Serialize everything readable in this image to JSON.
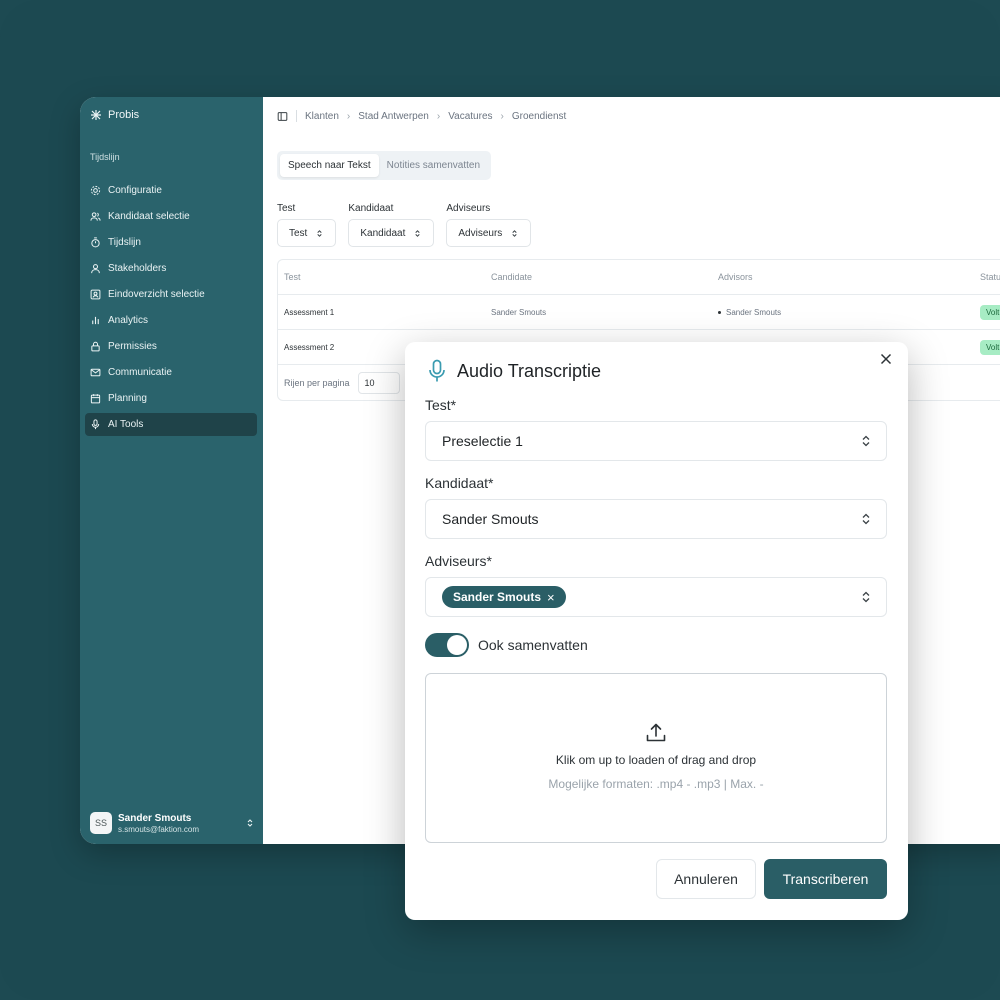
{
  "brand": {
    "name": "Probis"
  },
  "sidebar": {
    "section_label": "Tijdslijn",
    "items": [
      {
        "label": "Configuratie",
        "icon": "gear-icon"
      },
      {
        "label": "Kandidaat selectie",
        "icon": "users-icon"
      },
      {
        "label": "Tijdslijn",
        "icon": "timer-icon"
      },
      {
        "label": "Stakeholders",
        "icon": "user-icon"
      },
      {
        "label": "Eindoverzicht selectie",
        "icon": "id-card-icon"
      },
      {
        "label": "Analytics",
        "icon": "bar-chart-icon"
      },
      {
        "label": "Permissies",
        "icon": "lock-icon"
      },
      {
        "label": "Communicatie",
        "icon": "mail-icon"
      },
      {
        "label": "Planning",
        "icon": "calendar-icon"
      },
      {
        "label": "AI Tools",
        "icon": "microphone-icon"
      }
    ],
    "active": "AI Tools",
    "user": {
      "initials": "SS",
      "name": "Sander Smouts",
      "email": "s.smouts@faktion.com"
    }
  },
  "breadcrumb": [
    "Klanten",
    "Stad Antwerpen",
    "Vacatures",
    "Groendienst"
  ],
  "tabs": [
    {
      "label": "Speech naar Tekst",
      "active": true
    },
    {
      "label": "Notities samenvatten",
      "active": false
    }
  ],
  "filters": [
    {
      "label": "Test",
      "value": "Test"
    },
    {
      "label": "Kandidaat",
      "value": "Kandidaat"
    },
    {
      "label": "Adviseurs",
      "value": "Adviseurs"
    }
  ],
  "table": {
    "headers": [
      "Test",
      "Candidate",
      "Advisors",
      "Status"
    ],
    "header_status_visible": "Statu",
    "rows": [
      {
        "test": "Assessment 1",
        "candidate": "Sander Smouts",
        "advisor": "Sander Smouts",
        "status": "Volt"
      },
      {
        "test": "Assessment 2",
        "candidate": "",
        "advisor": "",
        "status": "Volt"
      }
    ],
    "rows_per_page_label": "Rijen per pagina",
    "rows_per_page_value": "10"
  },
  "modal": {
    "title": "Audio Transcriptie",
    "test_label": "Test*",
    "test_value": "Preselectie 1",
    "candidate_label": "Kandidaat*",
    "candidate_value": "Sander Smouts",
    "advisors_label": "Adviseurs*",
    "advisor_chip": "Sander Smouts",
    "toggle_label": "Ook samenvatten",
    "toggle_on": true,
    "upload_main": "Klik om up to loaden of drag and drop",
    "upload_sub": "Mogelijke formaten: .mp4 - .mp3 | Max. -",
    "cancel_label": "Annuleren",
    "submit_label": "Transcriberen"
  },
  "colors": {
    "background": "#1c4951",
    "sidebar": "#2a636c",
    "accent": "#2a5e66",
    "status_badge": "#a7ecc4"
  }
}
